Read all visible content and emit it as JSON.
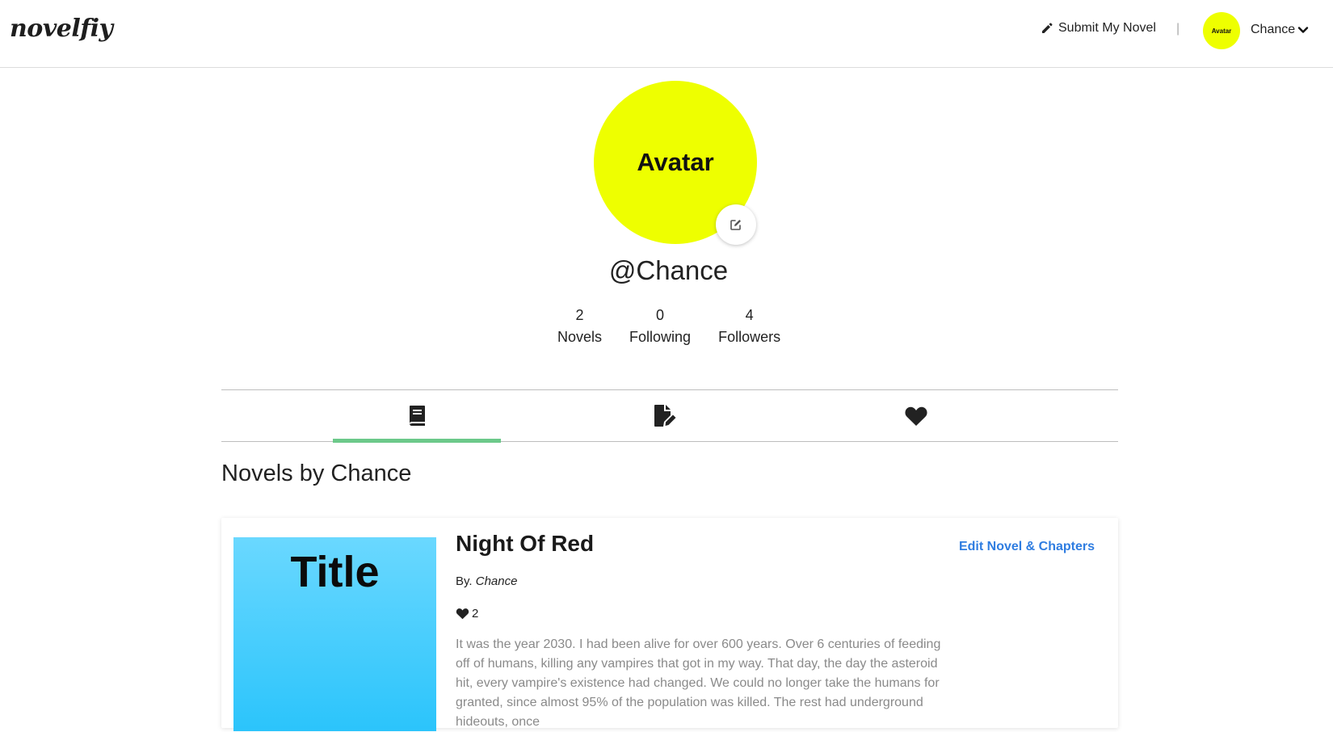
{
  "header": {
    "logo": "novelfiy",
    "submit_label": "Submit My Novel",
    "separator": "|",
    "avatar_label": "Avatar",
    "user_name": "Chance"
  },
  "profile": {
    "avatar_label": "Avatar",
    "handle": "@Chance",
    "stats": [
      {
        "value": "2",
        "label": "Novels"
      },
      {
        "value": "0",
        "label": "Following"
      },
      {
        "value": "4",
        "label": "Followers"
      }
    ]
  },
  "tabs": [
    {
      "icon": "book-icon",
      "active": true
    },
    {
      "icon": "file-edit-icon",
      "active": false
    },
    {
      "icon": "heart-icon",
      "active": false
    }
  ],
  "section_title": "Novels by Chance",
  "novel": {
    "cover_title": "Title",
    "title": "Night Of Red",
    "edit_label": "Edit Novel & Chapters",
    "by_prefix": "By.",
    "author": "Chance",
    "likes": "2",
    "synopsis": "It was the year 2030. I had been alive for over 600 years. Over 6 centuries of feeding off of humans, killing any vampires that got in my way. That day, the day the asteroid hit, every vampire's existence had changed. We could no longer take the humans for granted, since almost 95% of the population was killed. The rest had underground hideouts, once"
  },
  "colors": {
    "avatar_bg": "#eeff00",
    "tab_indicator": "#6cc98a",
    "link": "#2f7de1",
    "cover_top": "#6ad8ff",
    "cover_bottom": "#2bc4fb"
  }
}
